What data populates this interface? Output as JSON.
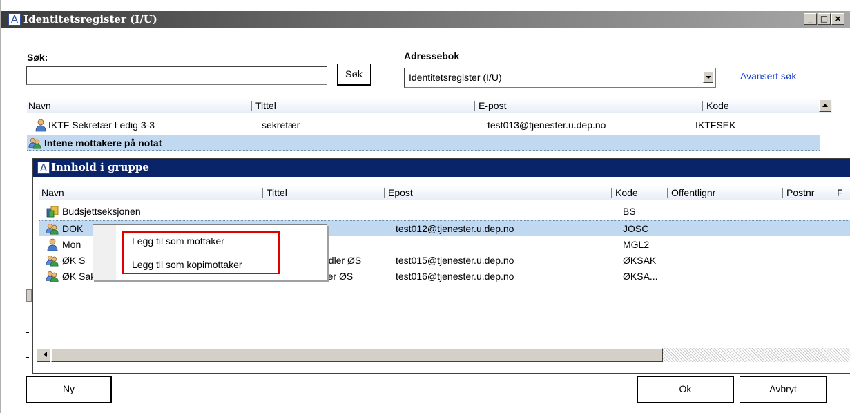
{
  "window": {
    "title": "Identitetsregister (I/U)",
    "app_icon": "A",
    "min_glyph": "_",
    "max_glyph": "□",
    "close_glyph": "×"
  },
  "search": {
    "label": "Søk:",
    "value": "",
    "placeholder": "",
    "button": "Søk"
  },
  "addressbook": {
    "label": "Adressebok",
    "selected": "Identitetsregister (I/U)",
    "advanced_link": "Avansert søk"
  },
  "main_list": {
    "columns": [
      "Navn",
      "Tittel",
      "E-post",
      "Kode"
    ],
    "rows": [
      {
        "icon": "person-icon",
        "name": "IKTF Sekretær Ledig 3-3",
        "title": "sekretær",
        "email": "test013@tjenester.u.dep.no",
        "code": "IKTFSEK"
      },
      {
        "icon": "group-icon",
        "name": "Intene mottakere på notat",
        "title": "",
        "email": "",
        "code": "",
        "selected": true
      }
    ]
  },
  "group_dialog": {
    "title": "Innhold i gruppe",
    "app_icon": "A",
    "columns": [
      "Navn",
      "Tittel",
      "Epost",
      "Kode",
      "Offentlignr",
      "Postnr",
      "F"
    ],
    "rows": [
      {
        "icon": "org-unit-icon",
        "name": "Budsjettseksjonen",
        "title": "",
        "email": "",
        "code": "BS"
      },
      {
        "icon": "group-icon",
        "name": "DOK",
        "title": "",
        "email": "test012@tjenester.u.dep.no",
        "code": "JOSC",
        "selected": true
      },
      {
        "icon": "person-icon",
        "name": "Mon",
        "title": "",
        "email": "",
        "code": "MGL2"
      },
      {
        "icon": "group-icon",
        "name": "ØK S",
        "title": "ndler ØS",
        "email": "test015@tjenester.u.dep.no",
        "code": "ØKSAK"
      },
      {
        "icon": "group-icon",
        "name": "ØK Saksbehandler 2  Tone 4-4",
        "title": "saksbehandler ØS",
        "email": "test016@tjenester.u.dep.no",
        "code": "ØKSA..."
      }
    ]
  },
  "context_menu": {
    "items": [
      "Legg til som mottaker",
      "Legg til som kopimottaker"
    ],
    "highlight_color": "#e00000"
  },
  "footer": {
    "new_button": "Ny",
    "ok_button": "Ok",
    "cancel_button": "Avbryt"
  },
  "colors": {
    "selection": "#c0d8f0",
    "inner_title": "#0a246a",
    "link": "#1a3fd0"
  }
}
